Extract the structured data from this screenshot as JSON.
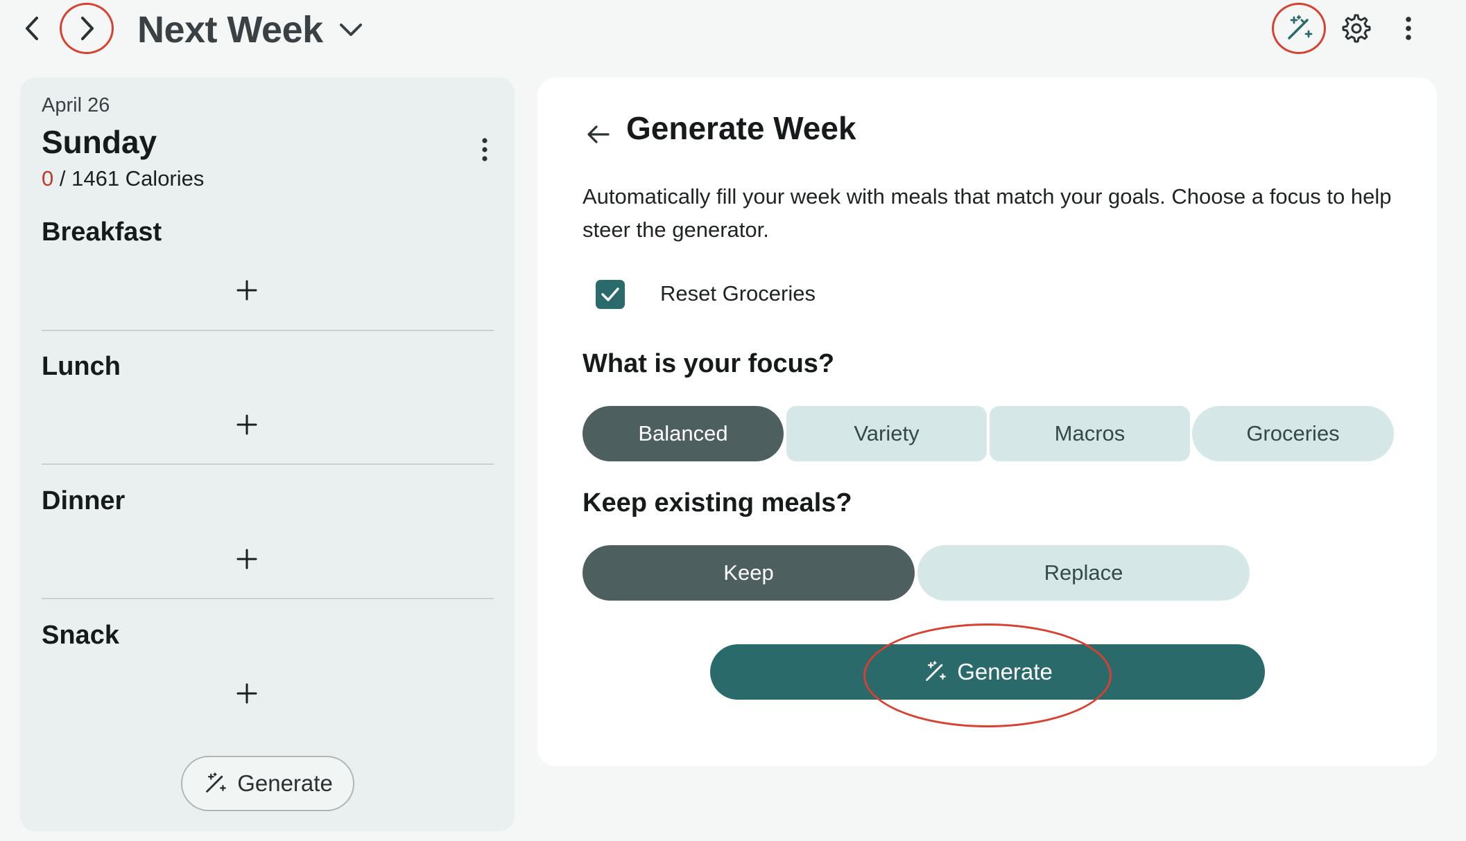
{
  "header": {
    "week_title": "Next Week",
    "icons": [
      "chevron-left-icon",
      "chevron-right-icon",
      "chevron-down-icon",
      "magic-wand-icon",
      "gear-icon",
      "more-vertical-icon"
    ]
  },
  "day": {
    "date": "April 26",
    "name": "Sunday",
    "calories_current": "0",
    "calories_total": "/ 1461 Calories",
    "meals": [
      {
        "label": "Breakfast"
      },
      {
        "label": "Lunch"
      },
      {
        "label": "Dinner"
      },
      {
        "label": "Snack"
      }
    ],
    "generate_label": "Generate"
  },
  "generate_week": {
    "title": "Generate Week",
    "description": "Automatically fill your week with meals that match your goals. Choose a focus to help steer the generator.",
    "reset_groceries": {
      "label": "Reset Groceries",
      "checked": true
    },
    "focus_question": "What is your focus?",
    "focus_options": [
      {
        "label": "Balanced",
        "selected": true
      },
      {
        "label": "Variety",
        "selected": false
      },
      {
        "label": "Macros",
        "selected": false
      },
      {
        "label": "Groceries",
        "selected": false
      }
    ],
    "keep_question": "Keep existing meals?",
    "keep_options": [
      {
        "label": "Keep",
        "selected": true
      },
      {
        "label": "Replace",
        "selected": false
      }
    ],
    "generate_label": "Generate"
  },
  "colors": {
    "accent": "#2b6a6a",
    "segment_selected": "#4d5f5e",
    "segment_unselected": "#d5e7e6",
    "annotation": "#d8402f",
    "calorie_current": "#c0392b"
  }
}
